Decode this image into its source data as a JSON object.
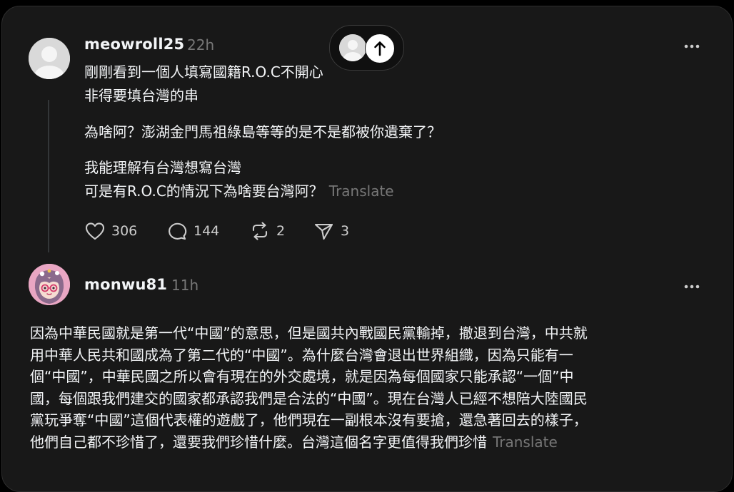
{
  "jump_to_top": {
    "icon": "arrow-up-icon"
  },
  "post1": {
    "username": "meowroll25",
    "time": "22h",
    "lines": [
      "剛剛看到一個人填寫國籍R.O.C不開心",
      "非得要填台灣的串",
      "為啥阿？澎湖金門馬祖綠島等等的是不是都被你遺棄了？",
      "我能理解有台灣想寫台灣",
      "可是有R.O.C的情況下為啥要台灣阿？"
    ],
    "translate": "Translate",
    "likes": "306",
    "replies": "144",
    "reposts": "2",
    "shares": "3"
  },
  "post2": {
    "username": "monwu81",
    "time": "11h",
    "lines": [
      "因為中華民國就是第一代“中國”的意思，但是國共內戰國民黨輸掉，撤退到台灣，中共就",
      "用中華人民共和國成為了第二代的“中國”。為什麼台灣會退出世界組織，因為只能有一",
      "個“中國”，中華民國之所以會有現在的外交處境，就是因為每個國家只能承認“一個”中",
      "國，每個跟我們建交的國家都承認我們是合法的“中國”。現在台灣人已經不想陪大陸國民",
      "黨玩爭奪“中國”這個代表權的遊戲了，他們現在一副根本沒有要搶，還急著回去的樣子，",
      "他們自己都不珍惜了，還要我們珍惜什麼。台灣這個名字更值得我們珍惜"
    ],
    "translate": "Translate"
  },
  "colors": {
    "background": "#000000",
    "panel": "#181818",
    "text": "#f3f5f7",
    "muted": "#777777",
    "thread_line": "#333638"
  }
}
